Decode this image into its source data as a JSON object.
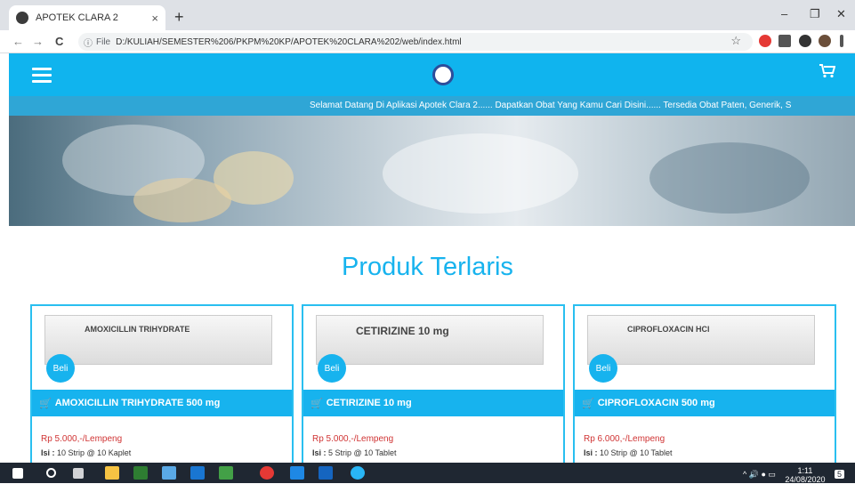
{
  "browser": {
    "tab_title": "APOTEK CLARA 2",
    "tab_close": "×",
    "new_tab": "+",
    "window_controls": {
      "minimize": "–",
      "restore": "❐",
      "close": "✕"
    },
    "nav": {
      "back": "←",
      "forward": "→",
      "reload": "C"
    },
    "address": {
      "info": "ⓘ",
      "scheme": "File",
      "url": "D:/KULIAH/SEMESTER%206/PKPM%20KP/APOTEK%20CLARA%202/web/index.html"
    },
    "star": "☆"
  },
  "site": {
    "cart_icon": "cart-icon",
    "marquee": "Selamat Datang Di Aplikasi Apotek Clara 2...... Dapatkan Obat Yang Kamu Cari Disini...... Tersedia Obat Paten, Generik, S",
    "section_title": "Produk Terlaris",
    "accent": "#17b3ee"
  },
  "products": [
    {
      "name": "AMOXICILLIN TRIHYDRATE 500 mg",
      "pack_text": "AMOXICILLIN TRIHYDRATE",
      "beli": "Beli",
      "price": "Rp 5.000,-/Lempeng",
      "isi_label": "Isi :",
      "isi_value": "10 Strip @ 10 Kaplet"
    },
    {
      "name": "CETIRIZINE 10 mg",
      "pack_text": "CETIRIZINE 10 mg",
      "beli": "Beli",
      "price": "Rp 5.000,-/Lempeng",
      "isi_label": "Isi :",
      "isi_value": "5 Strip @ 10 Tablet"
    },
    {
      "name": "CIPROFLOXACIN 500 mg",
      "pack_text": "CIPROFLOXACIN HCl",
      "beli": "Beli",
      "price": "Rp 6.000,-/Lempeng",
      "isi_label": "Isi :",
      "isi_value": "10 Strip @ 10 Tablet"
    }
  ],
  "taskbar": {
    "time": "1:11",
    "date": "24/08/2020",
    "notification_count": "5"
  }
}
